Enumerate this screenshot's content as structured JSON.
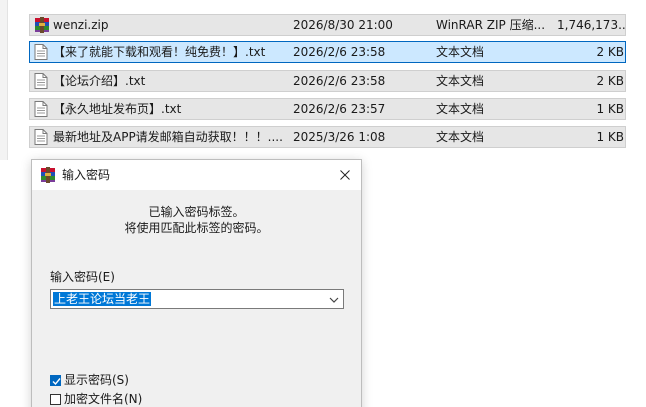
{
  "files": [
    {
      "name": "wenzi.zip",
      "date": "2026/8/30 21:00",
      "type": "WinRAR ZIP 压缩...",
      "size": "1,746,173...",
      "icon": "winrar-archive-icon",
      "selected": false
    },
    {
      "name": "【来了就能下载和观看！纯免费！】.txt",
      "date": "2026/2/6 23:58",
      "type": "文本文档",
      "size": "2 KB",
      "icon": "text-file-icon",
      "selected": true
    },
    {
      "name": "【论坛介绍】.txt",
      "date": "2026/2/6 23:58",
      "type": "文本文档",
      "size": "2 KB",
      "icon": "text-file-icon",
      "selected": false
    },
    {
      "name": "【永久地址发布页】.txt",
      "date": "2026/2/6 23:57",
      "type": "文本文档",
      "size": "1 KB",
      "icon": "text-file-icon",
      "selected": false
    },
    {
      "name": "最新地址及APP请发邮箱自动获取！！！....",
      "date": "2025/3/26 1:08",
      "type": "文本文档",
      "size": "1 KB",
      "icon": "text-file-icon",
      "selected": false
    }
  ],
  "dialog": {
    "title": "输入密码",
    "message_line1": "已输入密码标签。",
    "message_line2": "将使用匹配此标签的密码。",
    "password_label": "输入密码(E)",
    "password_value": "上老王论坛当老王",
    "show_password_label": "显示密码(S)",
    "show_password_checked": true,
    "encrypt_filenames_label": "加密文件名(N)",
    "encrypt_filenames_checked": false
  },
  "colors": {
    "selected_row_bg": "#cce8ff",
    "selected_row_border": "#0067c0",
    "row_bg": "#e6e6e6",
    "input_highlight": "#0078d7",
    "dialog_bg": "#f0f0f0"
  }
}
